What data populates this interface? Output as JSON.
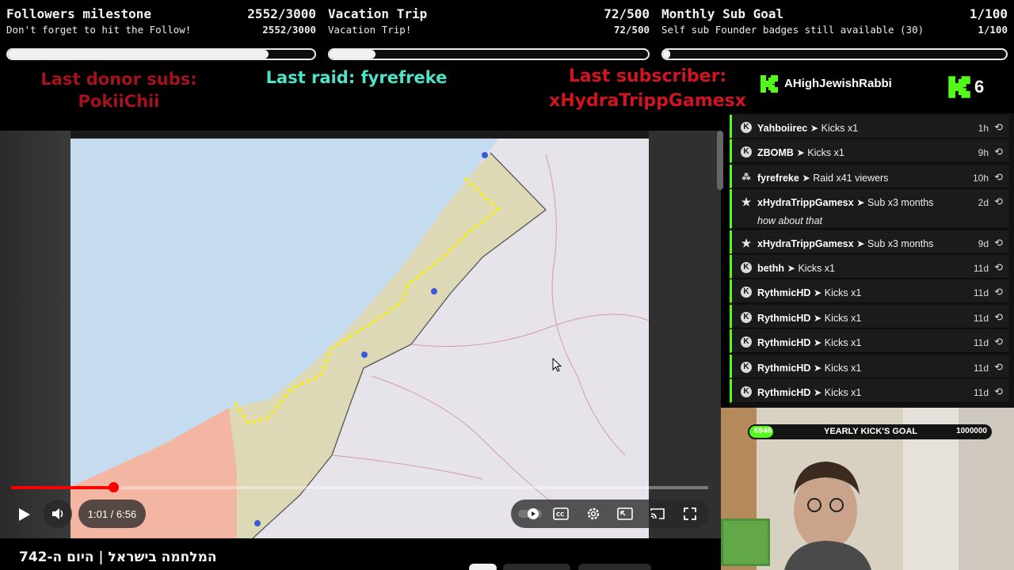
{
  "goals": [
    {
      "title": "Followers milestone",
      "count": "2552/3000",
      "subtitle": "Don't forget to hit the Follow!",
      "subcount": "2552/3000",
      "progress": 0.85
    },
    {
      "title": "Vacation Trip",
      "count": "72/500",
      "subtitle": "Vacation Trip!",
      "subcount": "72/500",
      "progress": 0.144
    },
    {
      "title": "Monthly Sub Goal",
      "count": "1/100",
      "subtitle": "Self sub Founder badges still available (30)",
      "subcount": "1/100",
      "progress": 0.01
    }
  ],
  "banners": {
    "donor_label": "Last donor subs:",
    "donor_name": "PokiiChii",
    "raid_text": "Last raid: fyrefreke",
    "subscriber_label": "Last subscriber:",
    "subscriber_name": "xHydraTrippGamesx"
  },
  "kick": {
    "channel_name": "AHighJewishRabbi",
    "viewer_count": "6",
    "brand_color": "#52fb18"
  },
  "events": [
    {
      "icon": "kick-icon",
      "user": "Yahboiirec",
      "action": "➤ Kicks x1",
      "time": "1h"
    },
    {
      "icon": "kick-icon",
      "user": "ZBOMB",
      "action": "➤ Kicks x1",
      "time": "9h"
    },
    {
      "icon": "raid-icon",
      "user": "fyrefreke",
      "action": "➤ Raid x41 viewers",
      "time": "10h"
    },
    {
      "icon": "star-icon",
      "user": "xHydraTrippGamesx",
      "action": "➤ Sub x3 months",
      "time": "2d",
      "message": "how about that"
    },
    {
      "icon": "star-icon",
      "user": "xHydraTrippGamesx",
      "action": "➤ Sub x3 months",
      "time": "9d"
    },
    {
      "icon": "kick-icon",
      "user": "bethh",
      "action": "➤ Kicks x1",
      "time": "11d"
    },
    {
      "icon": "kick-icon",
      "user": "RythmicHD",
      "action": "➤ Kicks x1",
      "time": "11d"
    },
    {
      "icon": "kick-icon",
      "user": "RythmicHD",
      "action": "➤ Kicks x1",
      "time": "11d"
    },
    {
      "icon": "kick-icon",
      "user": "RythmicHD",
      "action": "➤ Kicks x1",
      "time": "11d"
    },
    {
      "icon": "kick-icon",
      "user": "RythmicHD",
      "action": "➤ Kicks x1",
      "time": "11d"
    },
    {
      "icon": "kick-icon",
      "user": "RythmicHD",
      "action": "➤ Kicks x1",
      "time": "11d"
    }
  ],
  "video": {
    "time_display": "1:01 / 6:56",
    "progress": 0.147,
    "title": "המלחמה בישראל | היום ה-742"
  },
  "kicks_goal": {
    "current": "6946",
    "label": "YEARLY KICK'S GOAL",
    "target": "1000000",
    "progress": 0.007
  }
}
